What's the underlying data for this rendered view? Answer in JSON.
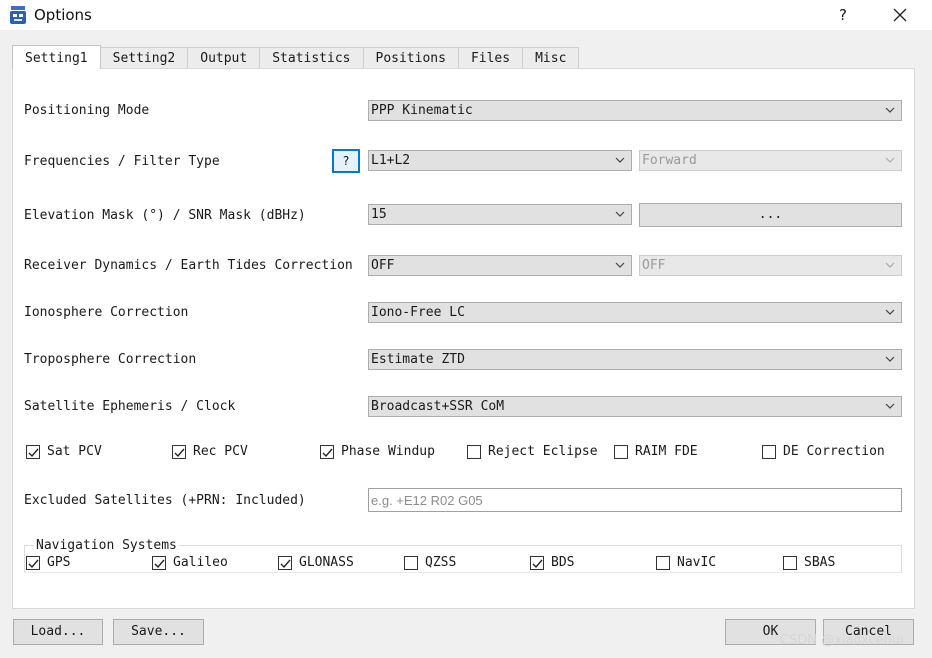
{
  "window": {
    "title": "Options",
    "help_label": "?"
  },
  "tabs": [
    "Setting1",
    "Setting2",
    "Output",
    "Statistics",
    "Positions",
    "Files",
    "Misc"
  ],
  "rows": {
    "positioning_mode": {
      "label": "Positioning Mode",
      "value": "PPP Kinematic"
    },
    "frequencies": {
      "label": "Frequencies / Filter Type",
      "help": "?",
      "value": "L1+L2",
      "filter_value": "Forward"
    },
    "elevation": {
      "label": "Elevation Mask (°) / SNR Mask (dBHz)",
      "value": "15",
      "snr_button": "..."
    },
    "receiver": {
      "label": "Receiver Dynamics / Earth Tides Correction",
      "value": "OFF",
      "tides_value": "OFF"
    },
    "ionosphere": {
      "label": "Ionosphere Correction",
      "value": "Iono-Free LC"
    },
    "troposphere": {
      "label": "Troposphere Correction",
      "value": "Estimate ZTD"
    },
    "ephemeris": {
      "label": "Satellite Ephemeris / Clock",
      "value": "Broadcast+SSR CoM"
    }
  },
  "options": [
    {
      "label": "Sat PCV",
      "checked": true
    },
    {
      "label": "Rec PCV",
      "checked": true
    },
    {
      "label": "Phase Windup",
      "checked": true
    },
    {
      "label": "Reject Eclipse",
      "checked": false
    },
    {
      "label": "RAIM FDE",
      "checked": false
    },
    {
      "label": "DE Correction",
      "checked": false
    }
  ],
  "excluded": {
    "label": "Excluded Satellites (+PRN: Included)",
    "placeholder": "e.g. +E12 R02 G05",
    "value": ""
  },
  "nav_systems": {
    "title": "Navigation Systems",
    "items": [
      {
        "label": "GPS",
        "checked": true
      },
      {
        "label": "Galileo",
        "checked": true
      },
      {
        "label": "GLONASS",
        "checked": true
      },
      {
        "label": "QZSS",
        "checked": false
      },
      {
        "label": "BDS",
        "checked": true
      },
      {
        "label": "NavIC",
        "checked": false
      },
      {
        "label": "SBAS",
        "checked": false
      }
    ]
  },
  "footer": {
    "load": "Load...",
    "save": "Save...",
    "ok": "OK",
    "cancel": "Cancel"
  },
  "watermark": "CSDN @xiaoxcehui",
  "colors": {
    "focus": "#0078d7",
    "panel": "#ffffff",
    "window": "#f0f0f0"
  }
}
